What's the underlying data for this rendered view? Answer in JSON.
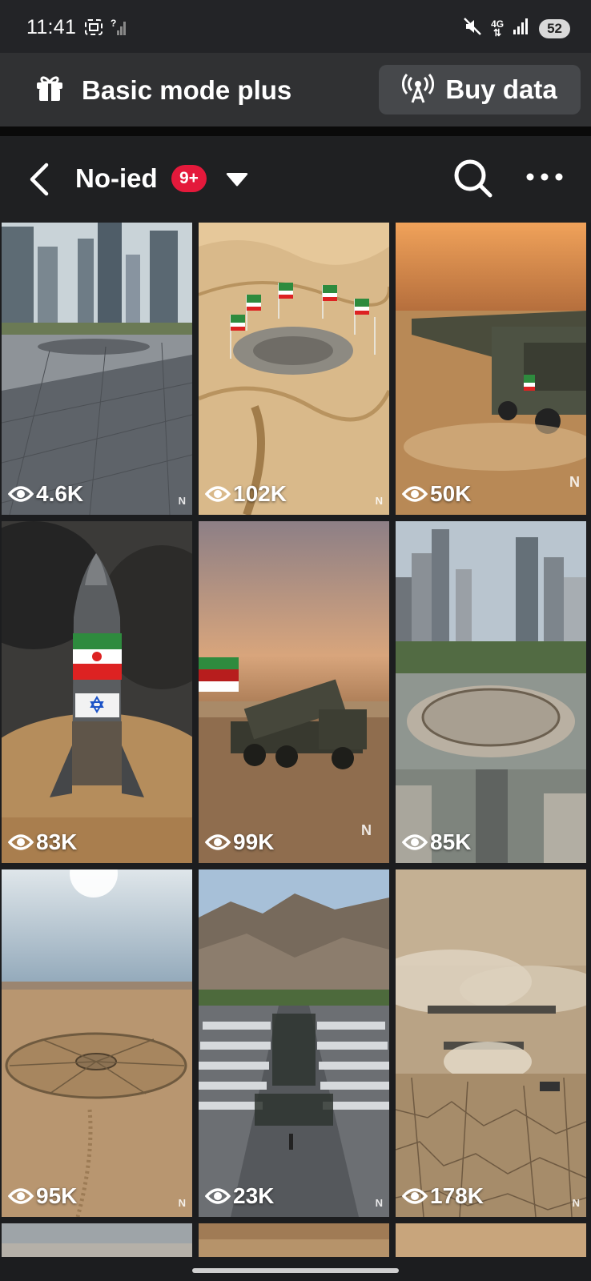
{
  "status_bar": {
    "time": "11:41",
    "network": "4G",
    "battery": "52",
    "icons": [
      "screenshot-icon",
      "signal-question-icon",
      "mute-icon",
      "data-arrows-icon",
      "signal-icon"
    ]
  },
  "banner": {
    "icon": "gift-icon",
    "title": "Basic mode plus",
    "buy_data": {
      "icon": "antenna-icon",
      "label": "Buy data"
    }
  },
  "header": {
    "back_icon": "back-arrow-icon",
    "title": "No-ied",
    "badge": "9+",
    "caret_icon": "caret-down-icon",
    "search_icon": "search-icon",
    "more_icon": "more-dots-icon"
  },
  "videos": [
    {
      "views": "4.6K",
      "watermark": "N",
      "scene": "city-plaza"
    },
    {
      "views": "102K",
      "watermark": "N",
      "scene": "desert-flags"
    },
    {
      "views": "50K",
      "watermark": "N",
      "scene": "sunset-launchers"
    },
    {
      "views": "83K",
      "watermark": "",
      "scene": "rocket-smoke"
    },
    {
      "views": "99K",
      "watermark": "N",
      "scene": "desert-launcher-truck"
    },
    {
      "views": "85K",
      "watermark": "",
      "scene": "city-crater"
    },
    {
      "views": "95K",
      "watermark": "N",
      "scene": "desert-circle"
    },
    {
      "views": "23K",
      "watermark": "N",
      "scene": "missile-parade"
    },
    {
      "views": "178K",
      "watermark": "N",
      "scene": "cracked-desert"
    }
  ],
  "colors": {
    "status_bg": "#232427",
    "banner_bg": "#303133",
    "button_bg": "#46484b",
    "header_bg": "#1f2022",
    "badge": "#e4193b"
  }
}
